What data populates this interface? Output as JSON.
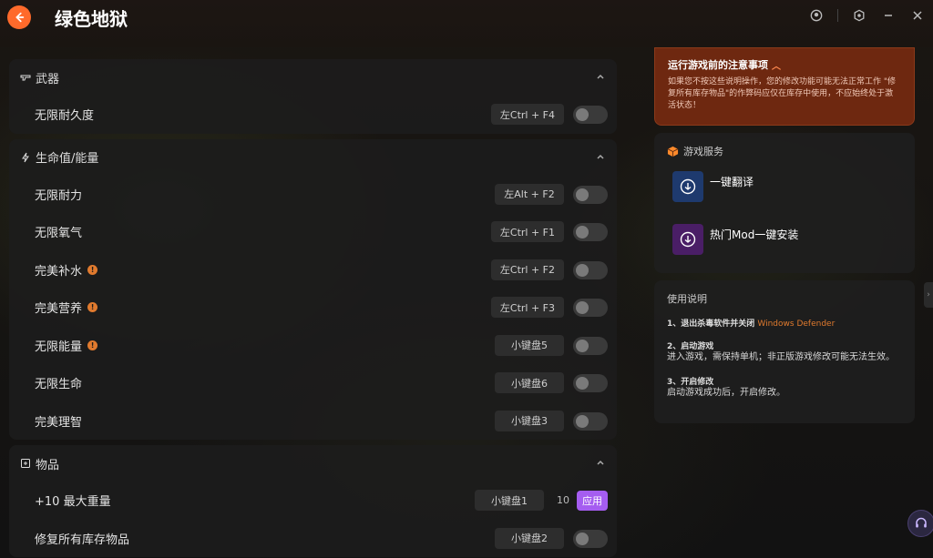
{
  "window": {
    "title": "绿色地狱"
  },
  "groups": [
    {
      "name": "武器",
      "icon": "gun-icon",
      "rows": [
        {
          "label": "无限耐久度",
          "hotkey": "左Ctrl + F4",
          "info": false
        }
      ]
    },
    {
      "name": "生命值/能量",
      "icon": "lightning-icon",
      "rows": [
        {
          "label": "无限耐力",
          "hotkey": "左Alt + F2",
          "info": false
        },
        {
          "label": "无限氧气",
          "hotkey": "左Ctrl + F1",
          "info": false
        },
        {
          "label": "完美补水",
          "hotkey": "左Ctrl + F2",
          "info": true
        },
        {
          "label": "完美营养",
          "hotkey": "左Ctrl + F3",
          "info": true
        },
        {
          "label": "无限能量",
          "hotkey": "小键盘5",
          "info": true
        },
        {
          "label": "无限生命",
          "hotkey": "小键盘6",
          "info": false
        },
        {
          "label": "完美理智",
          "hotkey": "小键盘3",
          "info": false
        }
      ]
    },
    {
      "name": "物品",
      "icon": "box-icon",
      "rows": [
        {
          "label": "+10 最大重量",
          "hotkey": "小键盘1",
          "value": "10",
          "apply": "应用"
        },
        {
          "label": "修复所有库存物品",
          "hotkey": "小键盘2",
          "info": false
        }
      ]
    }
  ],
  "notice": {
    "title": "运行游戏前的注意事项",
    "body": "如果您不按这些说明操作，您的修改功能可能无法正常工作 \"修复所有库存物品\"的作弊码应仅在库存中使用，不应始终处于激活状态！"
  },
  "services": {
    "title": "游戏服务",
    "items": [
      {
        "name": "一键翻译",
        "color": "#1e3a6e"
      },
      {
        "name": "热门Mod一键安装",
        "color": "#4a1e66"
      }
    ]
  },
  "usage": {
    "title": "使用说明",
    "steps": [
      {
        "title": "1、退出杀毒软件并关闭",
        "highlight": "Windows Defender",
        "desc": ""
      },
      {
        "title": "2、启动游戏",
        "highlight": "",
        "desc": "进入游戏，需保持单机；非正版游戏修改可能无法生效。"
      },
      {
        "title": "3、开启修改",
        "highlight": "",
        "desc": "启动游戏成功后，开启修改。"
      }
    ]
  },
  "colors": {
    "accent": "#ff6a2b",
    "apply": "#a55df0",
    "notice_bg": "#6e2810"
  }
}
